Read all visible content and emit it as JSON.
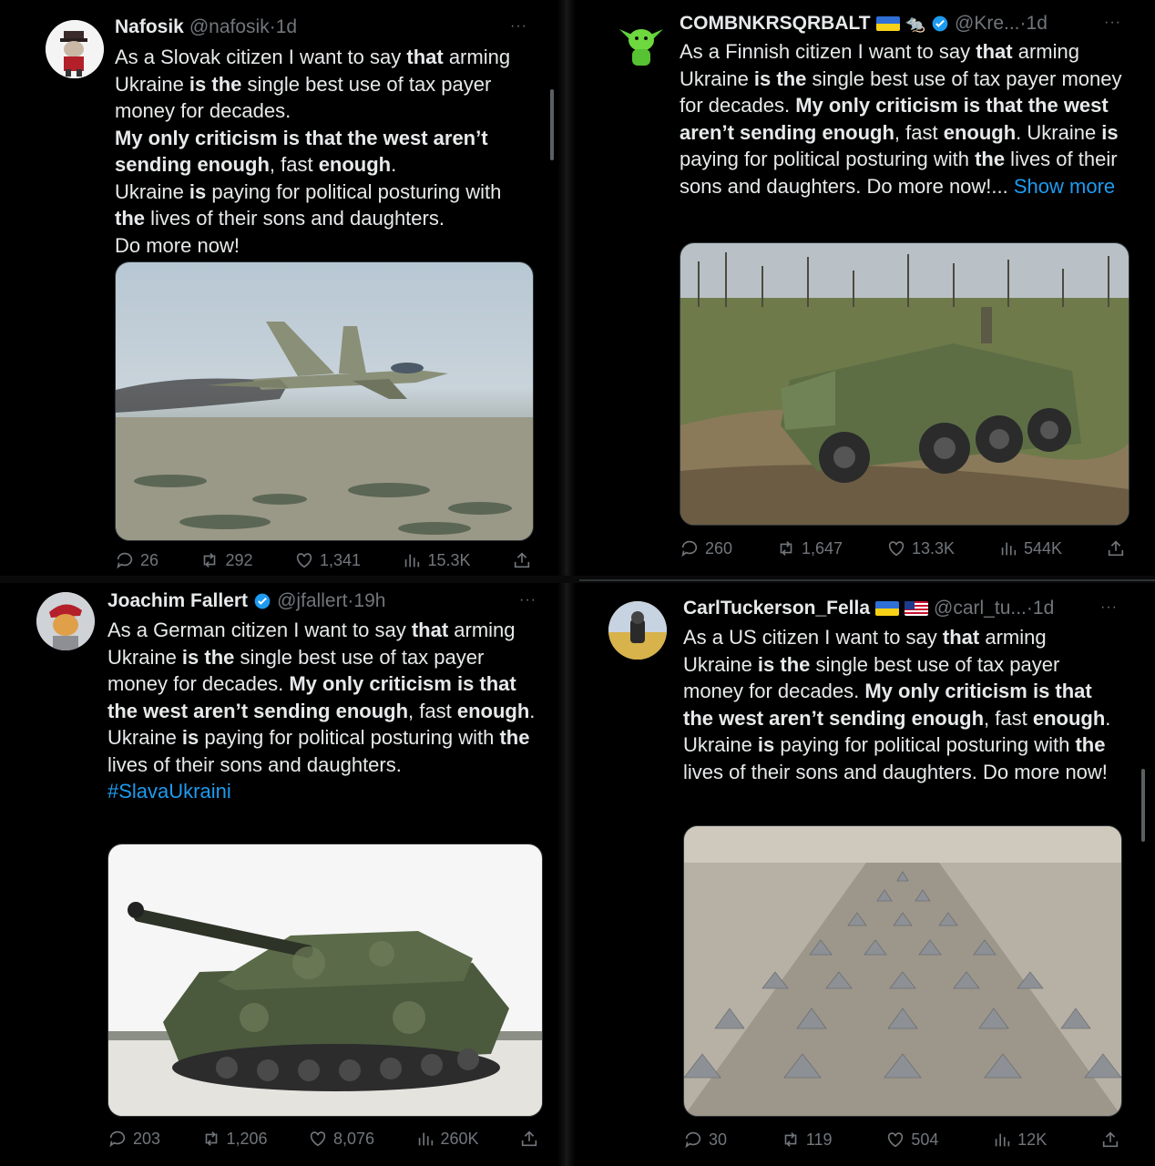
{
  "tweets": [
    {
      "name": "Nafosik",
      "handle": "@nafosik",
      "sep": "·",
      "time": "1d",
      "more": "···",
      "body": [
        {
          "t": "As a Slovak citizen I want to say "
        },
        {
          "b": "that"
        },
        {
          "t": " arming Ukraine "
        },
        {
          "b": "is the"
        },
        {
          "t": " single best use of tax payer money for decades."
        },
        {
          "br": true
        },
        {
          "b": "My only criticism is that the west aren’t sending enough"
        },
        {
          "t": ", fast "
        },
        {
          "b": "enough"
        },
        {
          "t": "."
        },
        {
          "br": true
        },
        {
          "t": "Ukraine "
        },
        {
          "b": "is"
        },
        {
          "t": " paying for political posturing with "
        },
        {
          "b": "the"
        },
        {
          "t": " lives of their sons and daughters."
        },
        {
          "br": true
        },
        {
          "t": "Do more now!"
        }
      ],
      "stats": {
        "replies": "26",
        "reposts": "292",
        "likes": "1,341",
        "views": "15.3K"
      }
    },
    {
      "name": "COMBNKRSQRBALT",
      "handle": "@Kre...",
      "sep": "·",
      "time": "1d",
      "more": "···",
      "body": [
        {
          "t": "As a Finnish citizen I want to say "
        },
        {
          "b": "that"
        },
        {
          "t": " arming Ukraine "
        },
        {
          "b": "is the"
        },
        {
          "t": " single best use of tax payer money for decades. "
        },
        {
          "b": "My only criticism is that the west aren’t sending enough"
        },
        {
          "t": ", fast "
        },
        {
          "b": "enough"
        },
        {
          "t": ". Ukraine "
        },
        {
          "b": "is"
        },
        {
          "t": " paying for political posturing with "
        },
        {
          "b": "the"
        },
        {
          "t": " lives of their sons and daughters.  Do more now!... "
        },
        {
          "link": "Show more"
        }
      ],
      "stats": {
        "replies": "260",
        "reposts": "1,647",
        "likes": "13.3K",
        "views": "544K"
      }
    },
    {
      "name": "Joachim Fallert",
      "handle": "@jfallert",
      "sep": "·",
      "time": "19h",
      "more": "···",
      "body": [
        {
          "t": "As a German citizen I want to say "
        },
        {
          "b": "that"
        },
        {
          "t": " arming Ukraine "
        },
        {
          "b": "is the"
        },
        {
          "t": " single best use of tax payer money for decades. "
        },
        {
          "b": "My only criticism is that the west aren’t sending enough"
        },
        {
          "t": ", fast "
        },
        {
          "b": "enough"
        },
        {
          "t": ". Ukraine "
        },
        {
          "b": "is"
        },
        {
          "t": " paying for political posturing with "
        },
        {
          "b": "the"
        },
        {
          "t": " lives of their sons and daughters."
        },
        {
          "br": true
        },
        {
          "link": "#SlavaUkraini"
        }
      ],
      "stats": {
        "replies": "203",
        "reposts": "1,206",
        "likes": "8,076",
        "views": "260K"
      }
    },
    {
      "name": "CarlTuckerson_Fella",
      "handle": "@carl_tu...",
      "sep": "·",
      "time": "1d",
      "more": "···",
      "body": [
        {
          "t": "As a US citizen I want to say "
        },
        {
          "b": "that"
        },
        {
          "t": " arming Ukraine "
        },
        {
          "b": "is the"
        },
        {
          "t": " single best use of tax payer money for decades. "
        },
        {
          "b": "My only criticism is that the west aren’t sending enough"
        },
        {
          "t": ", fast "
        },
        {
          "b": "enough"
        },
        {
          "t": ". Ukraine "
        },
        {
          "b": "is"
        },
        {
          "t": " paying for political posturing with "
        },
        {
          "b": "the"
        },
        {
          "t": " lives of their sons and daughters.  Do more now!"
        }
      ],
      "stats": {
        "replies": "30",
        "reposts": "119",
        "likes": "504",
        "views": "12K"
      }
    }
  ],
  "colors": {
    "background": "#000000",
    "text": "#e7e9ea",
    "muted": "#71767b",
    "link": "#1d9bf0",
    "verified": "#1d9bf0"
  },
  "icons": [
    "reply-icon",
    "repost-icon",
    "like-icon",
    "views-icon",
    "share-icon",
    "verified-icon",
    "more-icon"
  ]
}
